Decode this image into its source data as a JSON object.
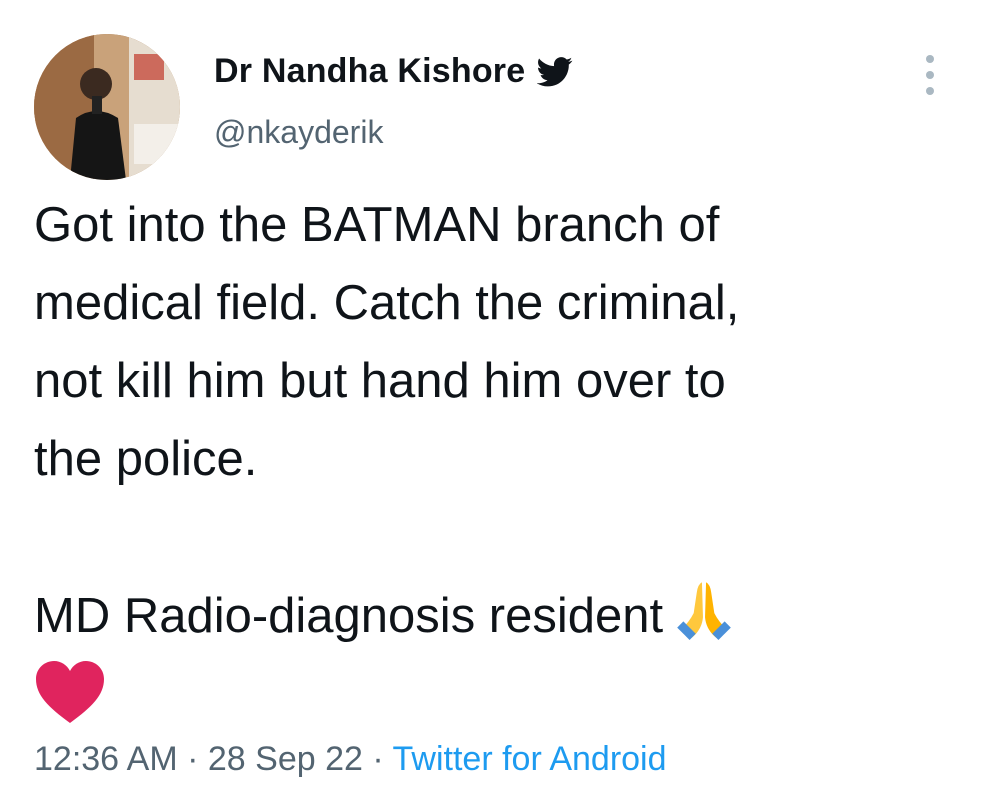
{
  "author": {
    "display_name": "Dr Nandha Kishore",
    "handle": "@nkayderik",
    "badge_icon": "twitter-bird-icon",
    "avatar": "profile-photo"
  },
  "tweet": {
    "lines": [
      "Got into the BATMAN branch of",
      "medical field. Catch the criminal,",
      "not kill him but hand him over to",
      "the police."
    ],
    "second_paragraph": "MD Radio-diagnosis resident",
    "emojis": [
      "folded-hands-icon",
      "red-heart-icon"
    ]
  },
  "meta": {
    "time": "12:36 AM",
    "separator": " · ",
    "date": "28 Sep 22",
    "source": "Twitter for Android"
  },
  "colors": {
    "text": "#0f1419",
    "secondary": "#536471",
    "link": "#1d9bf0",
    "heart": "#e0245e"
  }
}
